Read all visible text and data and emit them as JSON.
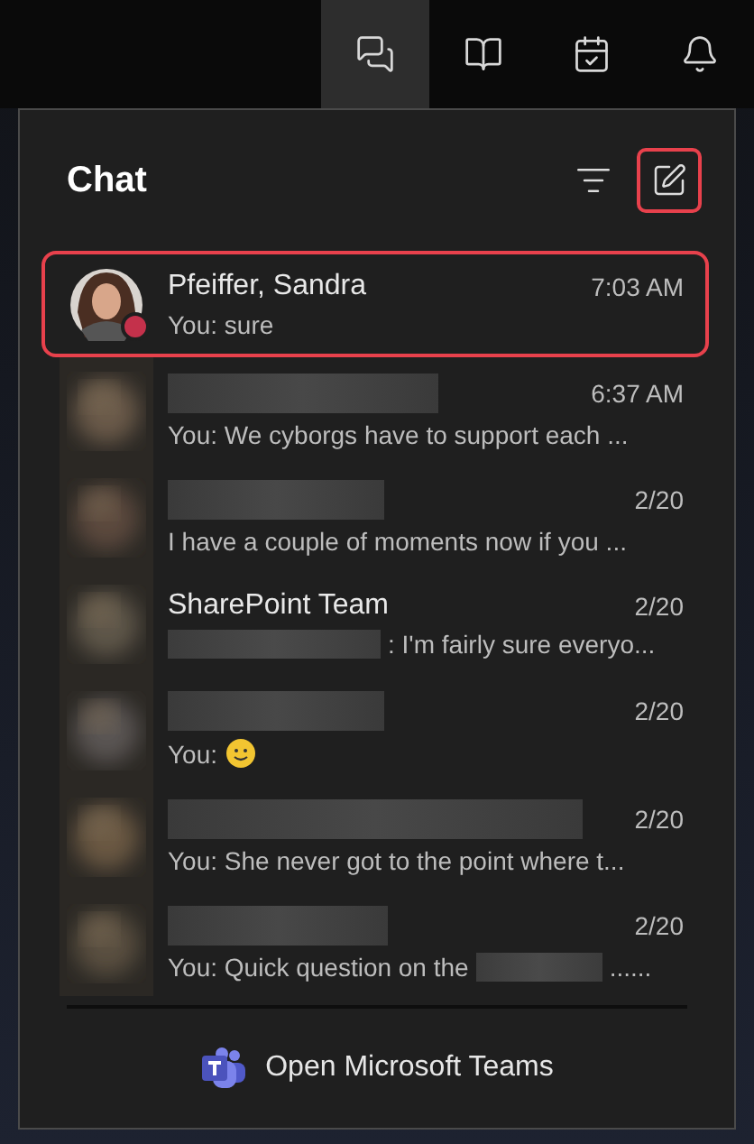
{
  "taskbar": {
    "icons": [
      {
        "kind": "chat",
        "selected": true
      },
      {
        "kind": "notebook",
        "selected": false
      },
      {
        "kind": "calendar",
        "selected": false
      },
      {
        "kind": "bell",
        "selected": false
      }
    ]
  },
  "panel": {
    "title": "Chat",
    "compose_highlighted": true
  },
  "chats": [
    {
      "name": "Pfeiffer, Sandra",
      "name_hidden": false,
      "time": "7:03 AM",
      "preview": [
        {
          "kind": "text",
          "text": "You: sure"
        }
      ],
      "color": "#c4314b",
      "highlighted": true
    },
    {
      "kind": "blurred",
      "name_hidden": true,
      "time": "6:37 AM",
      "preview": [
        {
          "kind": "text",
          "text": "You: We cyborgs have to support each ..."
        }
      ],
      "highlighted": false
    },
    {
      "kind": "blurred",
      "name_hidden": true,
      "time": "2/20",
      "preview": [
        {
          "kind": "text",
          "text": "I have a couple of moments now if you ..."
        }
      ],
      "highlighted": false
    },
    {
      "kind": "blurred",
      "name": "SharePoint Team",
      "name_hidden": false,
      "time": "2/20",
      "preview": [
        {
          "kind": "redacted"
        },
        {
          "kind": "text",
          "text": ": I'm fairly sure everyo..."
        }
      ],
      "highlighted": false
    },
    {
      "kind": "blurred",
      "name_hidden": true,
      "time": "2/20",
      "preview": [
        {
          "kind": "text",
          "text": "You:"
        },
        {
          "kind": "smiley"
        }
      ],
      "highlighted": false
    },
    {
      "kind": "blurred",
      "name_hidden": true,
      "time": "2/20",
      "preview": [
        {
          "kind": "text",
          "text": "You: She never got to the point where t..."
        }
      ],
      "highlighted": false
    },
    {
      "kind": "blurred",
      "name_hidden": true,
      "time": "2/20",
      "preview": [
        {
          "kind": "text",
          "text": "You: Quick question on the"
        },
        {
          "kind": "redacted"
        },
        {
          "kind": "text",
          "text": "......"
        }
      ],
      "highlighted": false
    }
  ],
  "footer": {
    "label": "Open Microsoft Teams"
  }
}
